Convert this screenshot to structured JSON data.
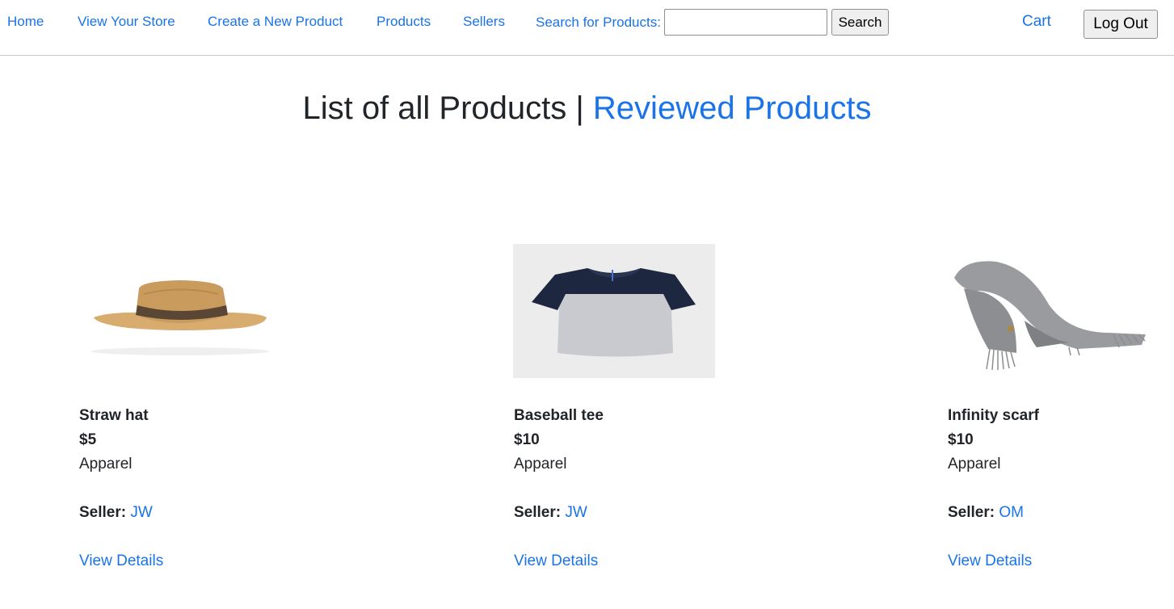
{
  "nav": {
    "home": "Home",
    "view_store": "View Your Store",
    "create_product": "Create a New Product",
    "products": "Products",
    "sellers": "Sellers",
    "search_label": "Search for Products:",
    "search_value": "",
    "search_button": "Search",
    "cart": "Cart",
    "logout": "Log Out"
  },
  "heading": {
    "title": "List of all Products",
    "separator": "|",
    "reviewed_link": "Reviewed Products"
  },
  "colors": {
    "link": "#1a73e8",
    "text": "#212529"
  },
  "products": [
    {
      "name": "Straw hat",
      "price": "$5",
      "category": "Apparel",
      "seller_label": "Seller:",
      "seller": "JW",
      "details": "View Details",
      "image_icon": "straw-hat-image"
    },
    {
      "name": "Baseball tee",
      "price": "$10",
      "category": "Apparel",
      "seller_label": "Seller:",
      "seller": "JW",
      "details": "View Details",
      "image_icon": "baseball-tee-image"
    },
    {
      "name": "Infinity scarf",
      "price": "$10",
      "category": "Apparel",
      "seller_label": "Seller:",
      "seller": "OM",
      "details": "View Details",
      "image_icon": "infinity-scarf-image"
    }
  ]
}
